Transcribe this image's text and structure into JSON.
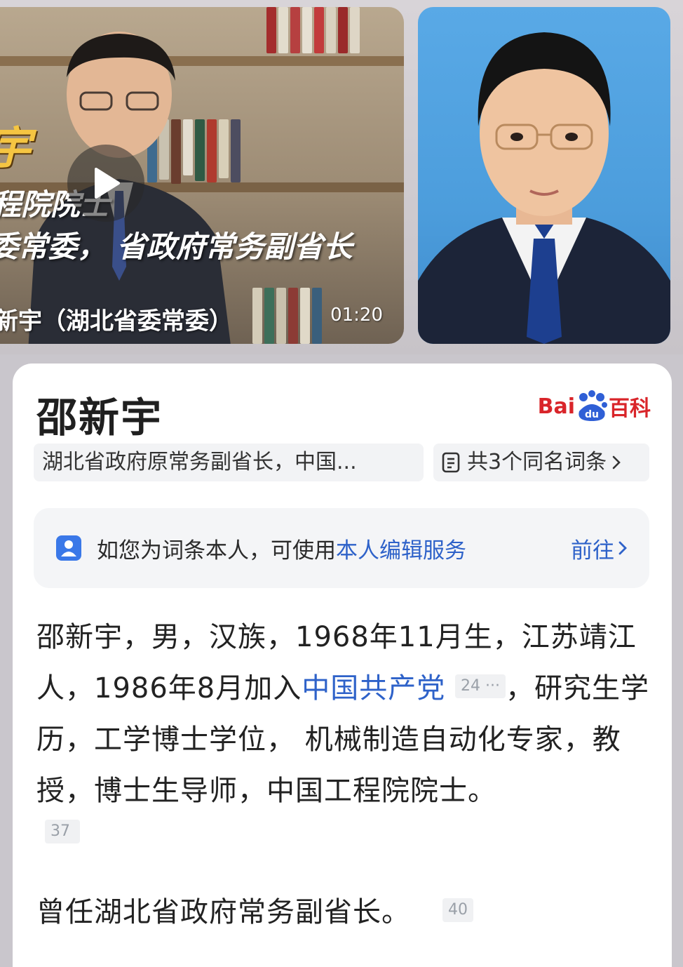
{
  "video": {
    "title_big": "宇",
    "line1": "程院院士",
    "line2": "委常委， 省政府常务副省长",
    "caption": "新宇（湖北省委常委）",
    "duration": "01:20"
  },
  "entry": {
    "title": "邵新宇",
    "logo": {
      "bai": "Bai",
      "du": "du",
      "baike": "百科"
    },
    "description_chip": "湖北省政府原常务副省长，中国...",
    "homonym_chip": "共3个同名词条",
    "notice": {
      "prefix": "如您为词条本人，可使用",
      "link": "本人编辑服务",
      "go": "前往"
    },
    "summary": {
      "part1": "邵新宇，男，汉族，1968年11月生，江苏靖江人，1986年8月加入",
      "link": "中国共产党",
      "ref1": "24",
      "part2": "，研究生学历，工学博士学位， 机械制造自动化专家，教授，博士生导师，中国工程院院士。",
      "ref2": "37"
    },
    "summary2": {
      "text": "曾任湖北省政府常务副省长。",
      "ref": "40"
    }
  },
  "colors": {
    "link": "#2e62c9",
    "baike_red": "#d9252a",
    "chip_bg": "#f2f3f5"
  }
}
